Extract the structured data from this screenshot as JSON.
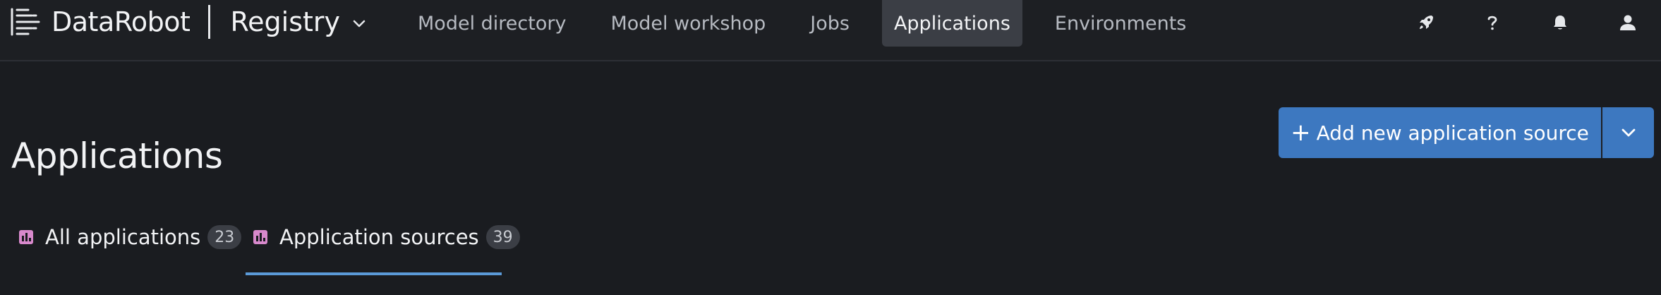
{
  "app": {
    "brand": "DataRobot",
    "product": "Registry"
  },
  "nav": {
    "items": [
      {
        "label": "Model directory",
        "active": false
      },
      {
        "label": "Model workshop",
        "active": false
      },
      {
        "label": "Jobs",
        "active": false
      },
      {
        "label": "Applications",
        "active": true
      },
      {
        "label": "Environments",
        "active": false
      }
    ]
  },
  "top_icons": [
    "rocket-icon",
    "help-icon",
    "bell-icon",
    "user-icon"
  ],
  "page": {
    "title": "Applications"
  },
  "actions": {
    "add_plus": "+",
    "add_label": "Add new application source"
  },
  "tabs": [
    {
      "label": "All applications",
      "count": "23",
      "active": false,
      "icon": "chart-icon"
    },
    {
      "label": "Application sources",
      "count": "39",
      "active": true,
      "icon": "chart-icon"
    }
  ],
  "colors": {
    "background": "#1a1c20",
    "topbar": "#1d1f23",
    "accent": "#3d78c0",
    "tab_underline": "#5b9ad8",
    "tab_icon": "#d889cc"
  }
}
